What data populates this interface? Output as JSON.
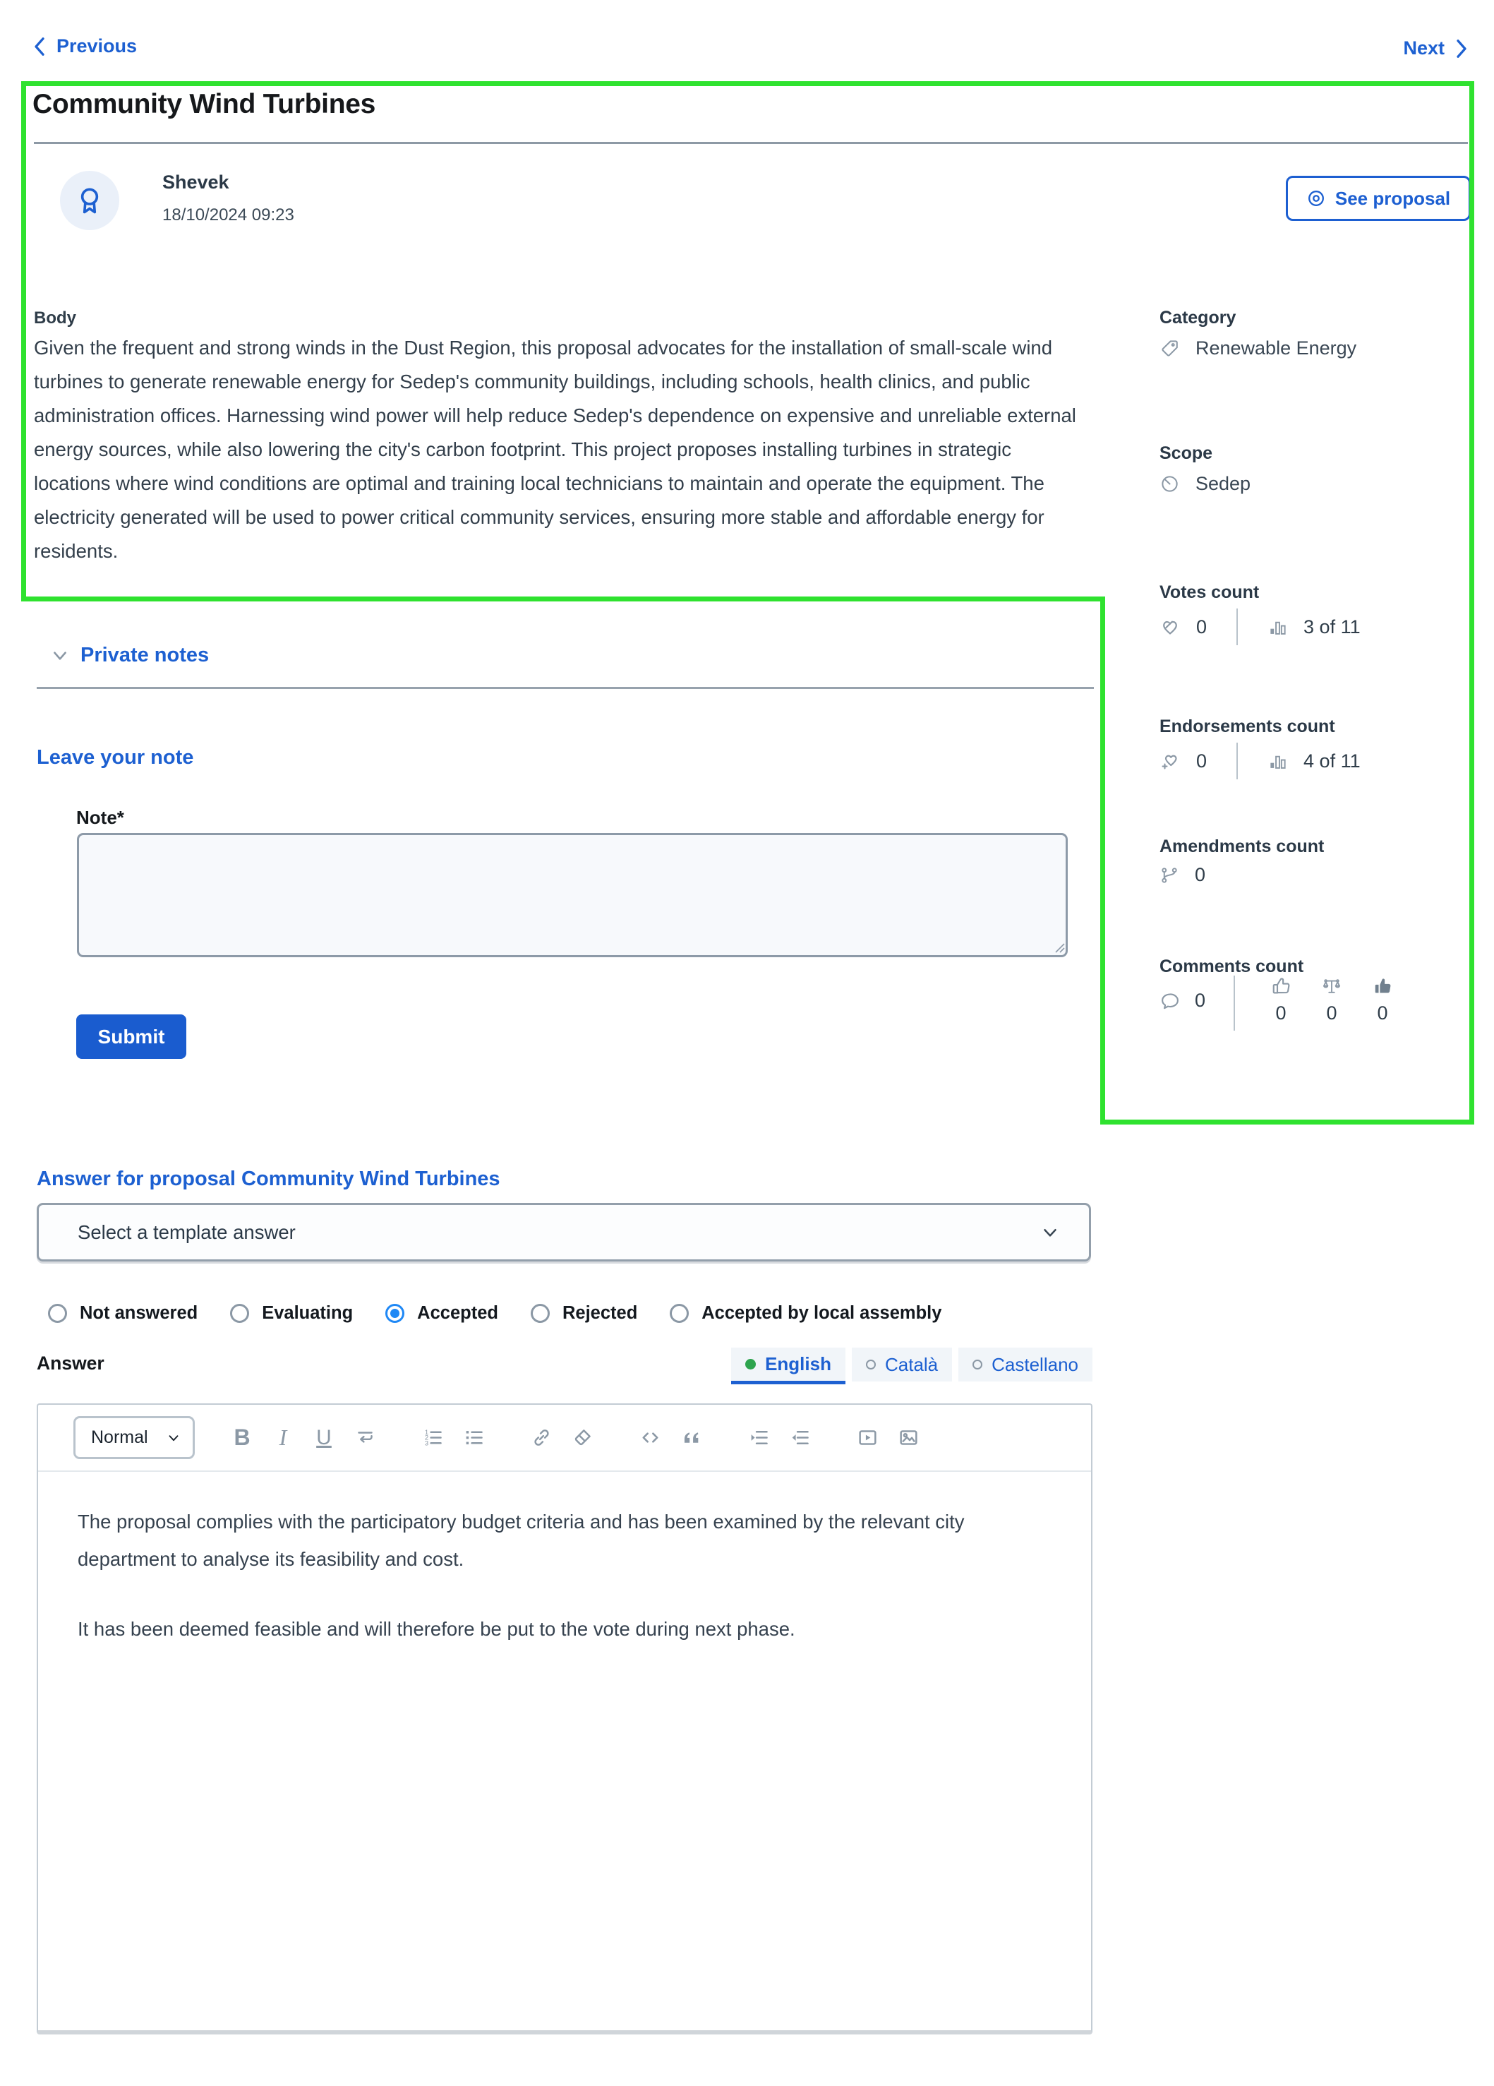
{
  "nav": {
    "previous": "Previous",
    "next": "Next"
  },
  "proposal": {
    "title": "Community Wind Turbines",
    "author": {
      "name": "Shevek",
      "date": "18/10/2024 09:23"
    },
    "see_proposal_label": "See proposal",
    "body_label": "Body",
    "body": "Given the frequent and strong winds in the Dust Region, this proposal advocates for the installation of small-scale wind turbines to generate renewable energy for Sedep's community buildings, including schools, health clinics, and public administration offices. Harnessing wind power will help reduce Sedep's dependence on expensive and unreliable external energy sources, while also lowering the city's carbon footprint. This project proposes installing turbines in strategic locations where wind conditions are optimal and training local technicians to maintain and operate the equipment. The electricity generated will be used to power critical community services, ensuring more stable and affordable energy for residents."
  },
  "sidebar": {
    "category": {
      "label": "Category",
      "value": "Renewable Energy"
    },
    "scope": {
      "label": "Scope",
      "value": "Sedep"
    },
    "votes": {
      "label": "Votes count",
      "count": "0",
      "ranking": "3 of 11"
    },
    "endorsements": {
      "label": "Endorsements count",
      "count": "0",
      "ranking": "4 of 11"
    },
    "amendments": {
      "label": "Amendments count",
      "count": "0"
    },
    "comments": {
      "label": "Comments count",
      "count": "0",
      "positive": "0",
      "neutral": "0",
      "negative": "0"
    }
  },
  "private_notes": {
    "title": "Private notes",
    "leave_note_title": "Leave your note",
    "note_label": "Note*",
    "note_value": "",
    "submit_label": "Submit"
  },
  "answer": {
    "heading": "Answer for proposal Community Wind Turbines",
    "template_placeholder": "Select a template answer",
    "statuses": [
      {
        "label": "Not answered",
        "selected": false
      },
      {
        "label": "Evaluating",
        "selected": false
      },
      {
        "label": "Accepted",
        "selected": true
      },
      {
        "label": "Rejected",
        "selected": false
      },
      {
        "label": "Accepted by local assembly",
        "selected": false
      }
    ],
    "answer_label": "Answer",
    "languages": [
      {
        "label": "English",
        "filled": true,
        "active": true
      },
      {
        "label": "Català",
        "filled": false,
        "active": false
      },
      {
        "label": "Castellano",
        "filled": false,
        "active": false
      }
    ],
    "editor": {
      "format": "Normal",
      "paragraphs": [
        "The proposal complies with the participatory budget criteria and has been examined by the relevant city department to analyse its feasibility and cost.",
        "It has been deemed feasible and will therefore be put to the vote during next phase."
      ]
    }
  },
  "colors": {
    "accent_blue": "#1d60d1",
    "button_blue": "#1a5ccf",
    "radio_selected_blue": "#1f88f5",
    "annotation_green": "#2fe22f",
    "translated_dot_green": "#2da44e",
    "icon_gray": "#8b98a5"
  }
}
